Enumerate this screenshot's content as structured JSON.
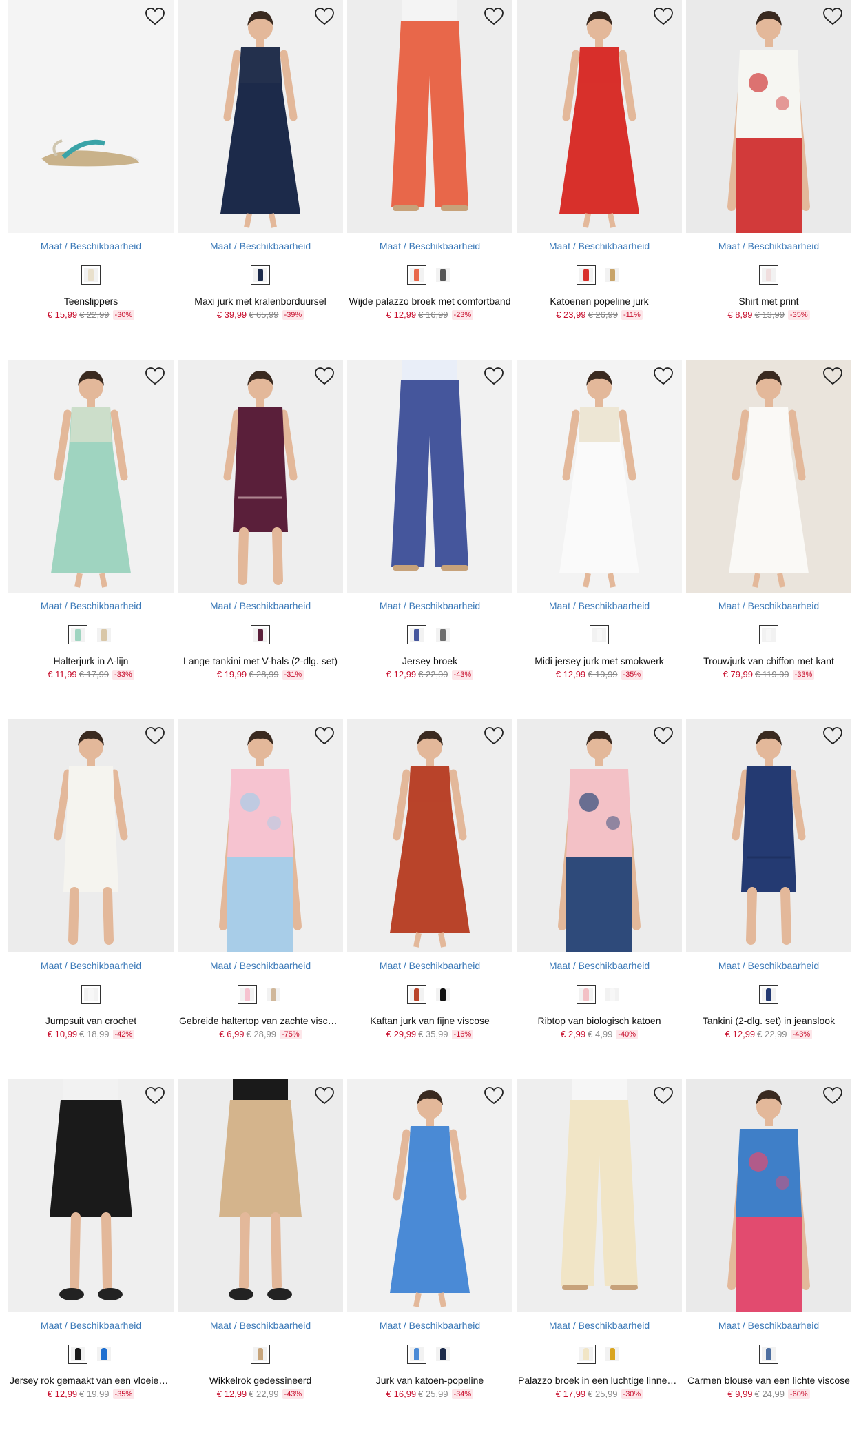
{
  "availability_label": "Maat / Beschikbaarheid",
  "products": [
    {
      "name": "Teenslippers",
      "price": "€ 15,99",
      "old_price": "€ 22,99",
      "discount": "-30%",
      "bg": "#f4f4f4",
      "figure": "sandal",
      "main": "#c9b28a",
      "accent": "#3aa3a7",
      "swatches": [
        "#e9e0cc"
      ]
    },
    {
      "name": "Maxi jurk met kralenborduursel",
      "price": "€ 39,99",
      "old_price": "€ 65,99",
      "discount": "-39%",
      "bg": "#f0f0f0",
      "figure": "dress",
      "main": "#1c2a4a",
      "accent": "#2a3550",
      "swatches": [
        "#1c2a4a"
      ]
    },
    {
      "name": "Wijde palazzo broek met comfortband",
      "price": "€ 12,99",
      "old_price": "€ 16,99",
      "discount": "-23%",
      "bg": "#ededed",
      "figure": "pants",
      "main": "#e8674a",
      "accent": "#f4f4f4",
      "swatches": [
        "#e8674a",
        "#555555"
      ]
    },
    {
      "name": "Katoenen popeline jurk",
      "price": "€ 23,99",
      "old_price": "€ 26,99",
      "discount": "-11%",
      "bg": "#eeeeee",
      "figure": "dress",
      "main": "#d8302b",
      "accent": "#d8302b",
      "swatches": [
        "#d8302b",
        "#c8a46a"
      ]
    },
    {
      "name": "Shirt met print",
      "price": "€ 8,99",
      "old_price": "€ 13,99",
      "discount": "-35%",
      "bg": "#eaeaea",
      "figure": "top",
      "main": "#f6f6f2",
      "accent": "#d23a3a",
      "swatches": [
        "#f0dede"
      ]
    },
    {
      "name": "Halterjurk in A-lijn",
      "price": "€ 11,99",
      "old_price": "€ 17,99",
      "discount": "-33%",
      "bg": "#f1f1f1",
      "figure": "dress",
      "main": "#9fd4c0",
      "accent": "#f0e6d2",
      "swatches": [
        "#9fd4c0",
        "#d9c7a8"
      ]
    },
    {
      "name": "Lange tankini met V-hals (2-dlg. set)",
      "price": "€ 19,99",
      "old_price": "€ 28,99",
      "discount": "-31%",
      "bg": "#eeeeee",
      "figure": "short",
      "main": "#5a1f3a",
      "accent": "#e7c9c9",
      "swatches": [
        "#5a1f3a"
      ]
    },
    {
      "name": "Jersey broek",
      "price": "€ 12,99",
      "old_price": "€ 22,99",
      "discount": "-43%",
      "bg": "#f1f1f1",
      "figure": "pants",
      "main": "#45569c",
      "accent": "#e9eef8",
      "swatches": [
        "#45569c",
        "#6d6d6d"
      ]
    },
    {
      "name": "Midi jersey jurk met smokwerk",
      "price": "€ 12,99",
      "old_price": "€ 19,99",
      "discount": "-35%",
      "bg": "#f3f3f3",
      "figure": "dress",
      "main": "#fafafa",
      "accent": "#e2d6b4",
      "swatches": [
        "#f7f7f7"
      ]
    },
    {
      "name": "Trouwjurk van chiffon met kant",
      "price": "€ 79,99",
      "old_price": "€ 119,99",
      "discount": "-33%",
      "bg": "#eae4dc",
      "figure": "dress",
      "main": "#faf9f6",
      "accent": "#faf9f6",
      "swatches": [
        "#f7f7f7"
      ]
    },
    {
      "name": "Jumpsuit van crochet",
      "price": "€ 10,99",
      "old_price": "€ 18,99",
      "discount": "-42%",
      "bg": "#ececec",
      "figure": "short",
      "main": "#f5f4ef",
      "accent": "#f5f4ef",
      "swatches": [
        "#f7f7f7"
      ]
    },
    {
      "name": "Gebreide haltertop van zachte viscose",
      "price": "€ 6,99",
      "old_price": "€ 28,99",
      "discount": "-75%",
      "bg": "#efefef",
      "figure": "top",
      "main": "#f6c3d0",
      "accent": "#a8cde8",
      "swatches": [
        "#f6c3d0",
        "#d0b79a"
      ]
    },
    {
      "name": "Kaftan jurk van fijne viscose",
      "price": "€ 29,99",
      "old_price": "€ 35,99",
      "discount": "-16%",
      "bg": "#eeeeee",
      "figure": "dress",
      "main": "#b9442a",
      "accent": "#b9442a",
      "swatches": [
        "#b9442a",
        "#111111"
      ]
    },
    {
      "name": "Ribtop van biologisch katoen",
      "price": "€ 2,99",
      "old_price": "€ 4,99",
      "discount": "-40%",
      "bg": "#ececec",
      "figure": "top",
      "main": "#f3c1c6",
      "accent": "#2e4a7a",
      "swatches": [
        "#f3c1c6",
        "#f7f7f7"
      ]
    },
    {
      "name": "Tankini (2-dlg. set) in jeanslook",
      "price": "€ 12,99",
      "old_price": "€ 22,99",
      "discount": "-43%",
      "bg": "#ededed",
      "figure": "short",
      "main": "#243a72",
      "accent": "#1b2c5a",
      "swatches": [
        "#243a72"
      ]
    },
    {
      "name": "Jersey rok gemaakt van een vloeiende stof",
      "price": "€ 12,99",
      "old_price": "€ 19,99",
      "discount": "-35%",
      "bg": "#efefef",
      "figure": "skirt",
      "main": "#1a1a1a",
      "accent": "#f2f2f2",
      "swatches": [
        "#1a1a1a",
        "#1e6fd0"
      ]
    },
    {
      "name": "Wikkelrok gedessineerd",
      "price": "€ 12,99",
      "old_price": "€ 22,99",
      "discount": "-43%",
      "bg": "#ececec",
      "figure": "skirt",
      "main": "#d4b48c",
      "accent": "#1a1a1a",
      "swatches": [
        "#c7a57c"
      ]
    },
    {
      "name": "Jurk van katoen-popeline",
      "price": "€ 16,99",
      "old_price": "€ 25,99",
      "discount": "-34%",
      "bg": "#f1f1f1",
      "figure": "dress",
      "main": "#4a8ad6",
      "accent": "#4a8ad6",
      "swatches": [
        "#4a8ad6",
        "#1c2a4a"
      ]
    },
    {
      "name": "Palazzo broek in een luchtige linnen look",
      "price": "€ 17,99",
      "old_price": "€ 25,99",
      "discount": "-30%",
      "bg": "#eeeeee",
      "figure": "pants",
      "main": "#f1e5c6",
      "accent": "#f6f6f6",
      "swatches": [
        "#f1e5c6",
        "#d9a520"
      ]
    },
    {
      "name": "Carmen blouse van een lichte viscose",
      "price": "€ 9,99",
      "old_price": "€ 24,99",
      "discount": "-60%",
      "bg": "#eaeaea",
      "figure": "top",
      "main": "#3f7fc8",
      "accent": "#e24b6f",
      "swatches": [
        "#4e6fa0"
      ]
    }
  ]
}
